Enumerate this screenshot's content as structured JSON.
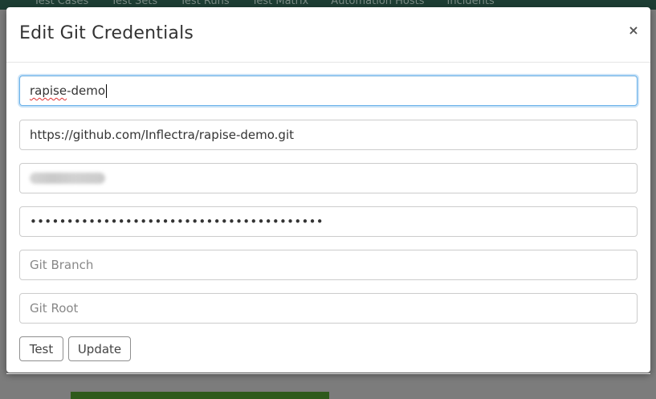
{
  "background": {
    "nav_items": [
      "Test Cases",
      "Test Sets",
      "Test Runs",
      "Test Matrix",
      "Automation Hosts",
      "Incidents"
    ]
  },
  "modal": {
    "title": "Edit Git Credentials",
    "close_label": "×",
    "fields": [
      {
        "name": "repository-name",
        "value": "rapise-demo",
        "placeholder": "",
        "focused": true
      },
      {
        "name": "repository-url",
        "value": "https://github.com/Inflectra/rapise-demo.git",
        "placeholder": ""
      },
      {
        "name": "username",
        "value": "",
        "placeholder": "",
        "blurred": true
      },
      {
        "name": "password",
        "value": "••••••••••••••••••••••••••••••••••••••••",
        "placeholder": ""
      },
      {
        "name": "git-branch",
        "value": "",
        "placeholder": "Git Branch"
      },
      {
        "name": "git-root",
        "value": "",
        "placeholder": "Git Root"
      }
    ],
    "buttons": {
      "test_label": "Test",
      "update_label": "Update"
    }
  },
  "colors": {
    "focus_border": "#66afe9",
    "nav_bg": "#1d3d33",
    "overlay": "#7c7c7c"
  }
}
